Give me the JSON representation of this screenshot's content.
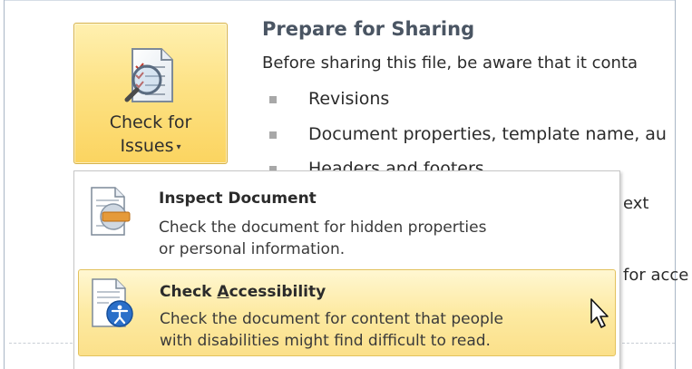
{
  "issues_button": {
    "label_line1": "Check for",
    "label_line2": "Issues",
    "caret": "▾",
    "icon": "checklist-icon"
  },
  "prepare": {
    "title": "Prepare for Sharing",
    "description": "Before sharing this file, be aware that it conta",
    "bullets": [
      "Revisions",
      "Document properties, template name, au",
      "Headers and footers"
    ],
    "right_fragments": [
      "ext",
      "for acce"
    ]
  },
  "menu": {
    "items": [
      {
        "title": "Inspect Document",
        "desc_line1": "Check the document for hidden properties",
        "desc_line2": "or personal information.",
        "icon": "inspect-document-icon"
      },
      {
        "title_pre": "Check ",
        "title_accel": "A",
        "title_post": "ccessibility",
        "desc_line1": "Check the document for content that people",
        "desc_line2": "with disabilities might find difficult to read.",
        "icon": "accessibility-icon"
      }
    ]
  },
  "colors": {
    "button_gold": "#fbd460",
    "hover_yellow": "#fdeaa2",
    "title_slate": "#4a5563"
  }
}
